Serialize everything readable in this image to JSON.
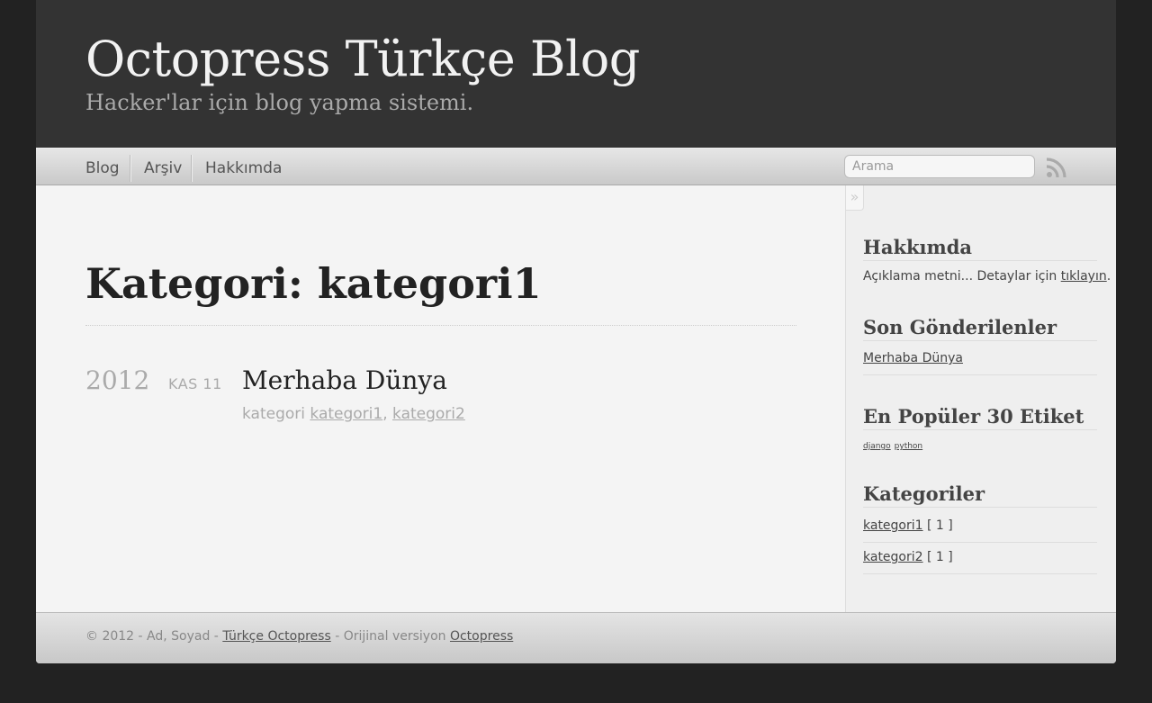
{
  "site": {
    "title": "Octopress Türkçe Blog",
    "subtitle": "Hacker'lar için blog yapma sistemi."
  },
  "nav": {
    "items": [
      {
        "label": "Blog"
      },
      {
        "label": "Arşiv"
      },
      {
        "label": "Hakkımda"
      }
    ],
    "search_placeholder": "Arama",
    "rss_icon": "rss-icon"
  },
  "main": {
    "heading": "Kategori: kategori1",
    "posts": [
      {
        "year": "2012",
        "day": "KAS 11",
        "title": "Merhaba Dünya",
        "categories_label": "kategori",
        "categories": [
          "kategori1",
          "kategori2"
        ]
      }
    ]
  },
  "sidebar": {
    "collapse_label": "»",
    "about": {
      "heading": "Hakkımda",
      "text": "Açıklama metni... Detaylar için",
      "link": "tıklayın",
      "suffix": "."
    },
    "recent": {
      "heading": "Son Gönderilenler",
      "items": [
        "Merhaba Dünya"
      ]
    },
    "tags": {
      "heading": "En Popüler 30 Etiket",
      "items": [
        "django",
        "python"
      ]
    },
    "categories": {
      "heading": "Kategoriler",
      "items": [
        {
          "name": "kategori1",
          "count": "[ 1 ]"
        },
        {
          "name": "kategori2",
          "count": "[ 1 ]"
        }
      ]
    }
  },
  "footer": {
    "prefix": "© 2012 - Ad, Soyad -",
    "link1": "Türkçe Octopress",
    "middle": "- Orijinal versiyon",
    "link2": "Octopress"
  },
  "colors": {
    "background": "#222222",
    "header": "#333333",
    "content": "#f4f4f4"
  }
}
